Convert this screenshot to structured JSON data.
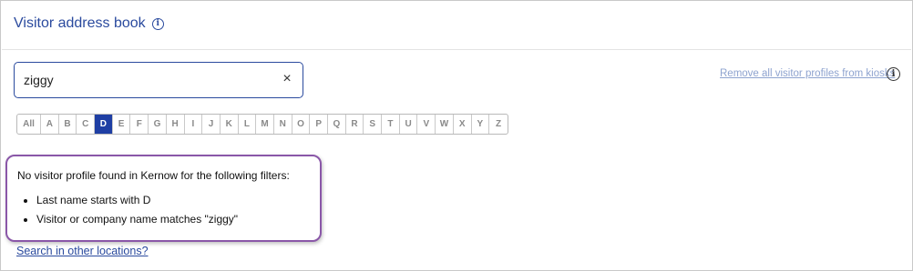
{
  "header": {
    "title": "Visitor address book",
    "info_icon": "info-icon"
  },
  "search": {
    "value": "ziggy",
    "clear_glyph": "×"
  },
  "remove_link": "Remove all visitor profiles from kiosks",
  "alphabet": {
    "letters": [
      "All",
      "A",
      "B",
      "C",
      "D",
      "E",
      "F",
      "G",
      "H",
      "I",
      "J",
      "K",
      "L",
      "M",
      "N",
      "O",
      "P",
      "Q",
      "R",
      "S",
      "T",
      "U",
      "V",
      "W",
      "X",
      "Y",
      "Z"
    ],
    "selected": "D",
    "active_color": "#1f3fa4"
  },
  "notice": {
    "message": "No visitor profile found in Kernow for the following filters:",
    "filters": [
      "Last name starts with D",
      "Visitor or company name matches \"ziggy\""
    ],
    "border_color": "#8a57a8"
  },
  "search_other_link": "Search in other locations?",
  "colors": {
    "accent": "#2a4a9e",
    "muted_link": "#8ea3cf"
  }
}
